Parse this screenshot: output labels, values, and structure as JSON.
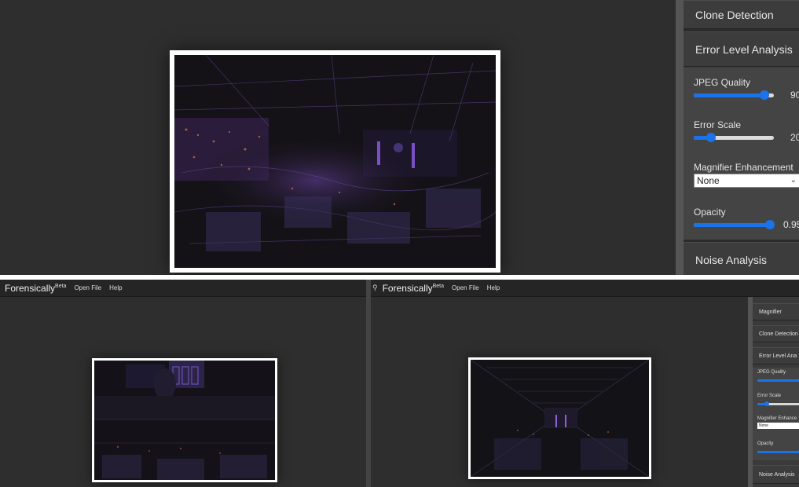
{
  "top": {
    "sidebar": {
      "clone_detection": "Clone Detection",
      "error_level_analysis": "Error Level Analysis",
      "jpeg_quality_label": "JPEG Quality",
      "jpeg_quality_value": "90",
      "jpeg_quality_fraction": 0.88,
      "error_scale_label": "Error Scale",
      "error_scale_value": "20",
      "error_scale_fraction": 0.22,
      "magnifier_label": "Magnifier Enhancement",
      "magnifier_value": "None",
      "opacity_label": "Opacity",
      "opacity_value": "0.95",
      "opacity_fraction": 0.95,
      "noise_analysis": "Noise Analysis"
    }
  },
  "left_window": {
    "brand": "Forensically",
    "brand_sup": "Beta",
    "menu": [
      "Open File",
      "Help"
    ]
  },
  "right_window": {
    "brand": "Forensically",
    "brand_sup": "Beta",
    "menu": [
      "Open File",
      "Help"
    ],
    "sidebar": {
      "magnifier": "Magnifier",
      "clone_detection": "Clone Detection",
      "error_level_analysis": "Error Level Ana",
      "jpeg_quality_label": "JPEG Quality",
      "jpeg_quality_fraction": 0.98,
      "error_scale_label": "Error Scale",
      "error_scale_fraction": 0.22,
      "magnifier_label": "Magnifier Enhance",
      "magnifier_value": "None",
      "opacity_label": "Opacity",
      "opacity_fraction": 0.98,
      "noise_analysis": "Noise Analysis"
    }
  },
  "colors": {
    "accent": "#1a73e8",
    "background": "#2e2e2e",
    "panel": "#3c3c3c"
  }
}
